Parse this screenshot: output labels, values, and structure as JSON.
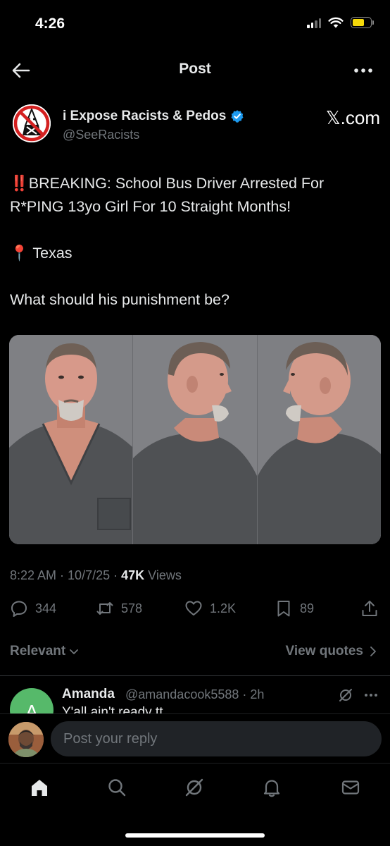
{
  "status_bar": {
    "time": "4:26"
  },
  "nav": {
    "title": "Post"
  },
  "post": {
    "author_name": "i Expose Racists & Pedos",
    "author_handle": "@SeeRacists",
    "source_mark": "𝕏.com",
    "text_alert": "‼️",
    "text_line1": "BREAKING: School Bus Driver Arrested For R*PING 13yo Girl For 10 Straight Months!",
    "location_pin": "📍",
    "location": "Texas",
    "question": "What should his punishment be?",
    "time": "8:22 AM",
    "date": "10/7/25",
    "views_count": "47K",
    "views_label": "Views"
  },
  "actions": {
    "replies": "344",
    "reposts": "578",
    "likes": "1.2K",
    "bookmarks": "89"
  },
  "sort": {
    "relevant_label": "Relevant",
    "view_quotes_label": "View quotes"
  },
  "reply": {
    "avatar_letter": "A",
    "name": "Amanda",
    "handle_time": "@amandacook5588 · 2h",
    "text": "Y'all ain't ready tt..."
  },
  "composer": {
    "placeholder": "Post your reply"
  },
  "colors": {
    "background": "#000000",
    "primary_text": "#e7e9ea",
    "secondary_text": "#71767b",
    "verified_blue": "#1d9bf0",
    "reply_avatar": "#56b96a"
  },
  "icons": {
    "back": "arrow-left-icon",
    "more": "more-horizontal-icon",
    "verified": "verified-badge-icon",
    "reply": "comment-icon",
    "repost": "repost-icon",
    "like": "heart-icon",
    "bookmark": "bookmark-icon",
    "share": "share-icon",
    "tabs": [
      "home-icon",
      "search-icon",
      "grok-icon",
      "bell-icon",
      "mail-icon"
    ]
  }
}
